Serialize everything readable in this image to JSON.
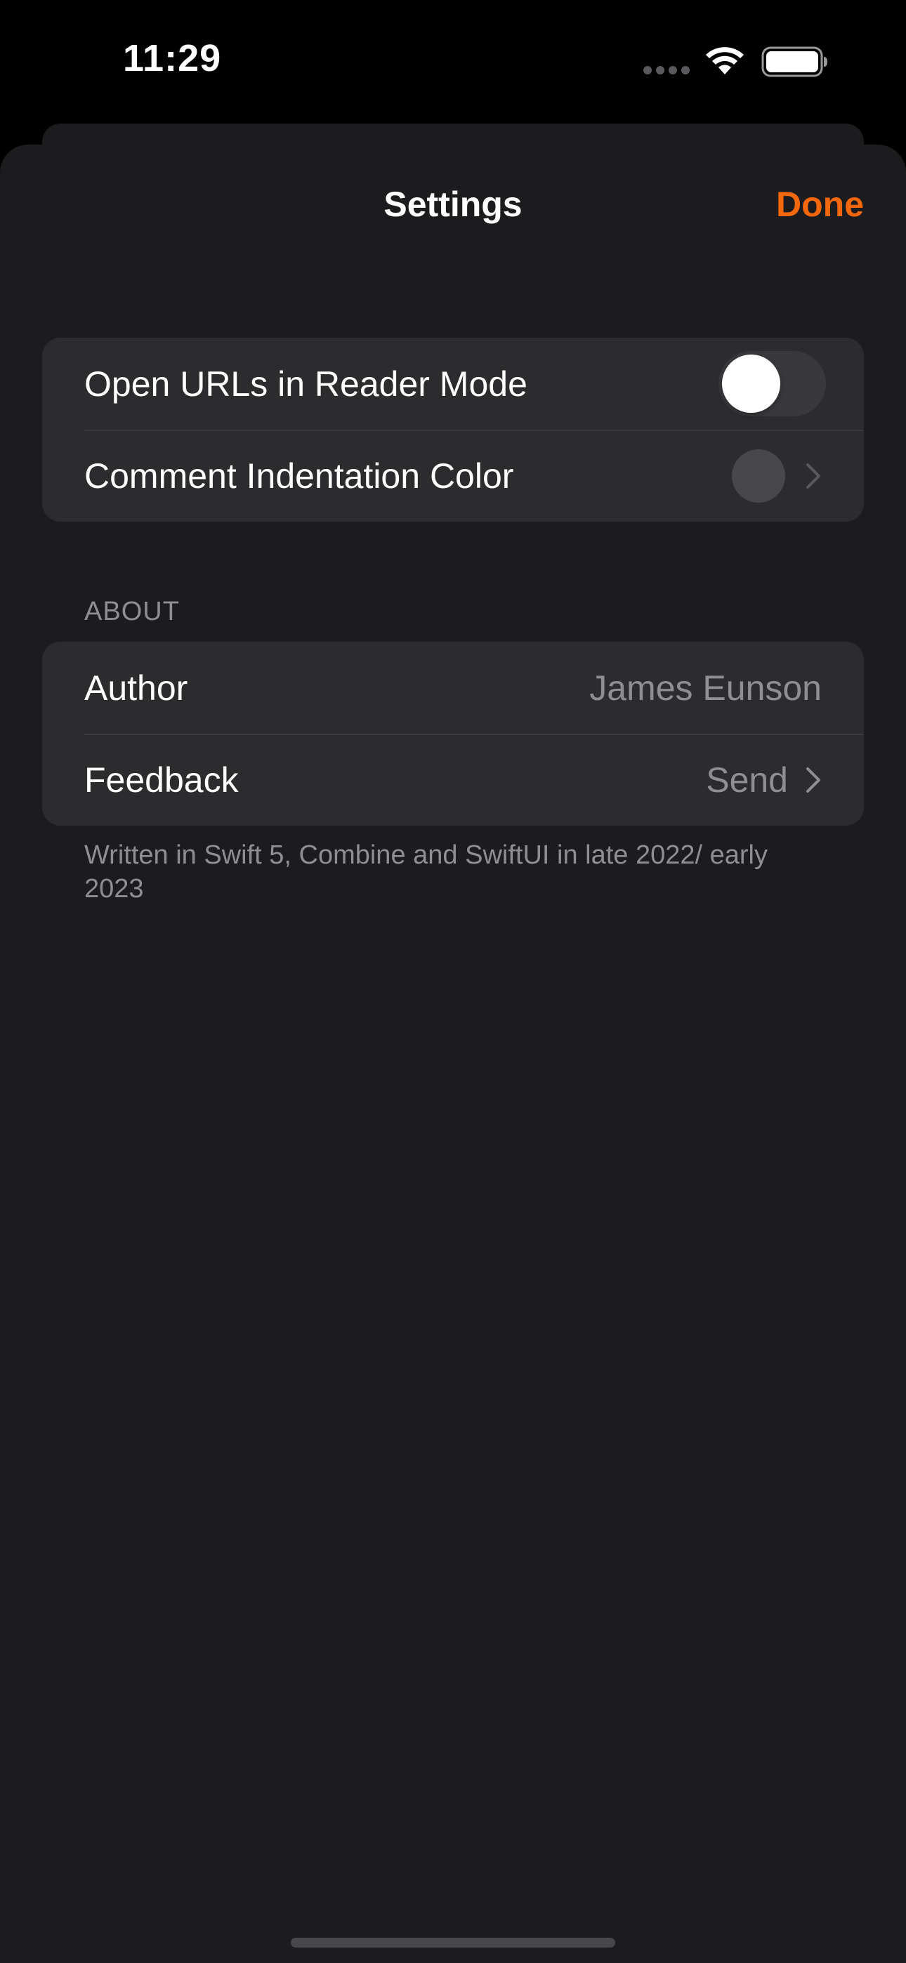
{
  "status_bar": {
    "time": "11:29",
    "icons": [
      "cellular-signal-icon",
      "wifi-icon",
      "battery-icon"
    ]
  },
  "nav": {
    "title": "Settings",
    "done_label": "Done",
    "accent_color": "#f5670b"
  },
  "general": {
    "rows": [
      {
        "label": "Open URLs in Reader Mode",
        "control": "toggle",
        "value": false
      },
      {
        "label": "Comment Indentation Color",
        "control": "color-picker",
        "swatch_color": "#48484a"
      }
    ]
  },
  "about": {
    "header": "ABOUT",
    "author_label": "Author",
    "author_value": "James Eunson",
    "feedback_label": "Feedback",
    "feedback_value": "Send",
    "footer": "Written in Swift 5, Combine and SwiftUI in late 2022/ early 2023"
  }
}
